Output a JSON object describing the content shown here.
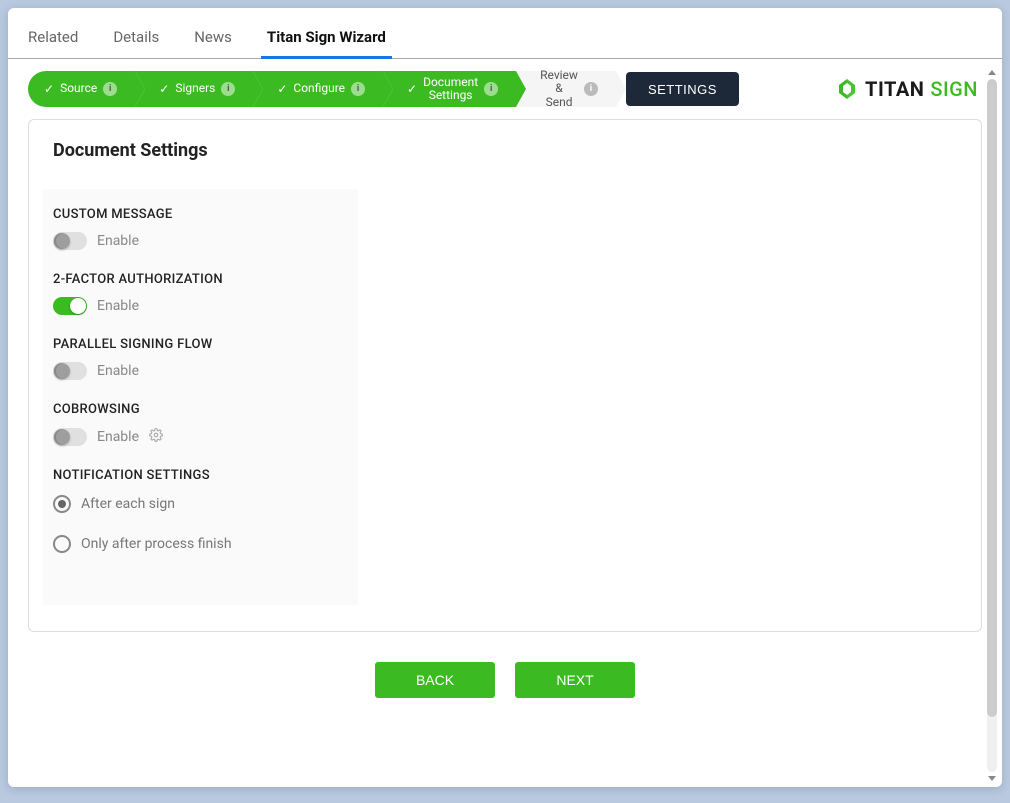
{
  "tabs": {
    "items": [
      {
        "label": "Related",
        "active": false
      },
      {
        "label": "Details",
        "active": false
      },
      {
        "label": "News",
        "active": false
      },
      {
        "label": "Titan Sign Wizard",
        "active": true
      }
    ]
  },
  "wizard": {
    "steps": [
      {
        "label": "Source",
        "done": true
      },
      {
        "label": "Signers",
        "done": true
      },
      {
        "label": "Configure",
        "done": true
      },
      {
        "label": "Document\nSettings",
        "done": true
      },
      {
        "label": "Review\n&\nSend",
        "done": false
      }
    ],
    "settings_button": "SETTINGS",
    "brand_titan": "TITAN",
    "brand_sign": "SIGN"
  },
  "panel": {
    "title": "Document Settings",
    "sections": {
      "custom_message": {
        "title": "CUSTOM MESSAGE",
        "toggle_label": "Enable",
        "enabled": false
      },
      "two_factor": {
        "title": "2-FACTOR AUTHORIZATION",
        "toggle_label": "Enable",
        "enabled": true
      },
      "parallel": {
        "title": "PARALLEL SIGNING FLOW",
        "toggle_label": "Enable",
        "enabled": false
      },
      "cobrowsing": {
        "title": "COBROWSING",
        "toggle_label": "Enable",
        "enabled": false,
        "has_gear": true
      },
      "notification": {
        "title": "NOTIFICATION SETTINGS",
        "options": [
          {
            "label": "After each sign",
            "selected": true
          },
          {
            "label": "Only after process finish",
            "selected": false
          }
        ]
      }
    }
  },
  "footer": {
    "back": "BACK",
    "next": "NEXT"
  }
}
